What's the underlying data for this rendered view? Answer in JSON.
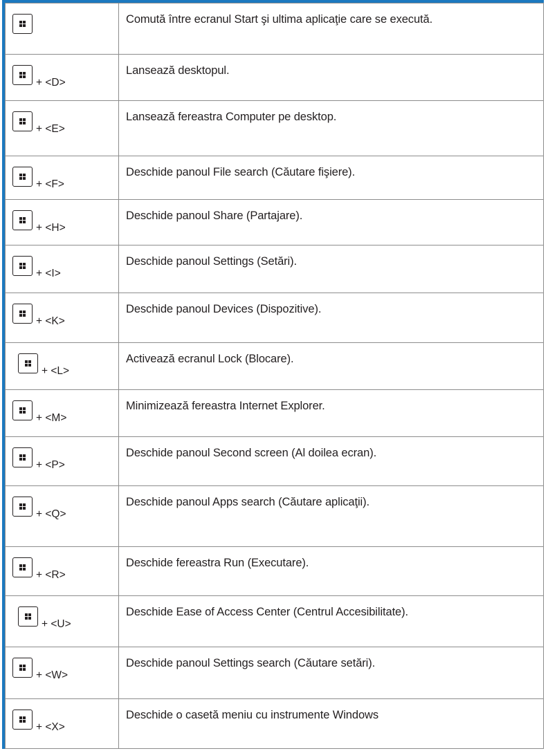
{
  "rows": [
    {
      "key": "",
      "desc": "Comută între ecranul Start şi ultima aplicaţie care se execută."
    },
    {
      "key": "+ <D>",
      "desc": "Lansează desktopul."
    },
    {
      "key": "+ <E>",
      "desc": "Lansează fereastra Computer pe desktop."
    },
    {
      "key": "+ <F>",
      "desc": "Deschide panoul File search (Căutare fişiere)."
    },
    {
      "key": "+ <H>",
      "desc": "Deschide panoul Share (Partajare)."
    },
    {
      "key": "+ <I>",
      "desc": "Deschide panoul Settings (Setări)."
    },
    {
      "key": "+ <K>",
      "desc": "Deschide panoul Devices (Dispozitive)."
    },
    {
      "key": "+ <L>",
      "desc": "Activează ecranul Lock (Blocare)."
    },
    {
      "key": "+ <M>",
      "desc": "Minimizează fereastra Internet Explorer."
    },
    {
      "key": "+ <P>",
      "desc": "Deschide panoul Second screen (Al doilea ecran)."
    },
    {
      "key": "+ <Q>",
      "desc": "Deschide panoul Apps search (Căutare aplicaţii)."
    },
    {
      "key": "+ <R>",
      "desc": "Deschide fereastra Run (Executare)."
    },
    {
      "key": "+ <U>",
      "desc": "Deschide Ease of Access Center (Centrul Accesibilitate)."
    },
    {
      "key": "+ <W>",
      "desc": "Deschide panoul Settings search (Căutare setări)."
    },
    {
      "key": "+ <X>",
      "desc": "Deschide o casetă meniu cu instrumente Windows"
    }
  ],
  "icons": {
    "key_icon": "windows-logo-icon"
  },
  "colors": {
    "accent": "#1c79bf",
    "border": "#8c8c8c",
    "text": "#231f20"
  }
}
